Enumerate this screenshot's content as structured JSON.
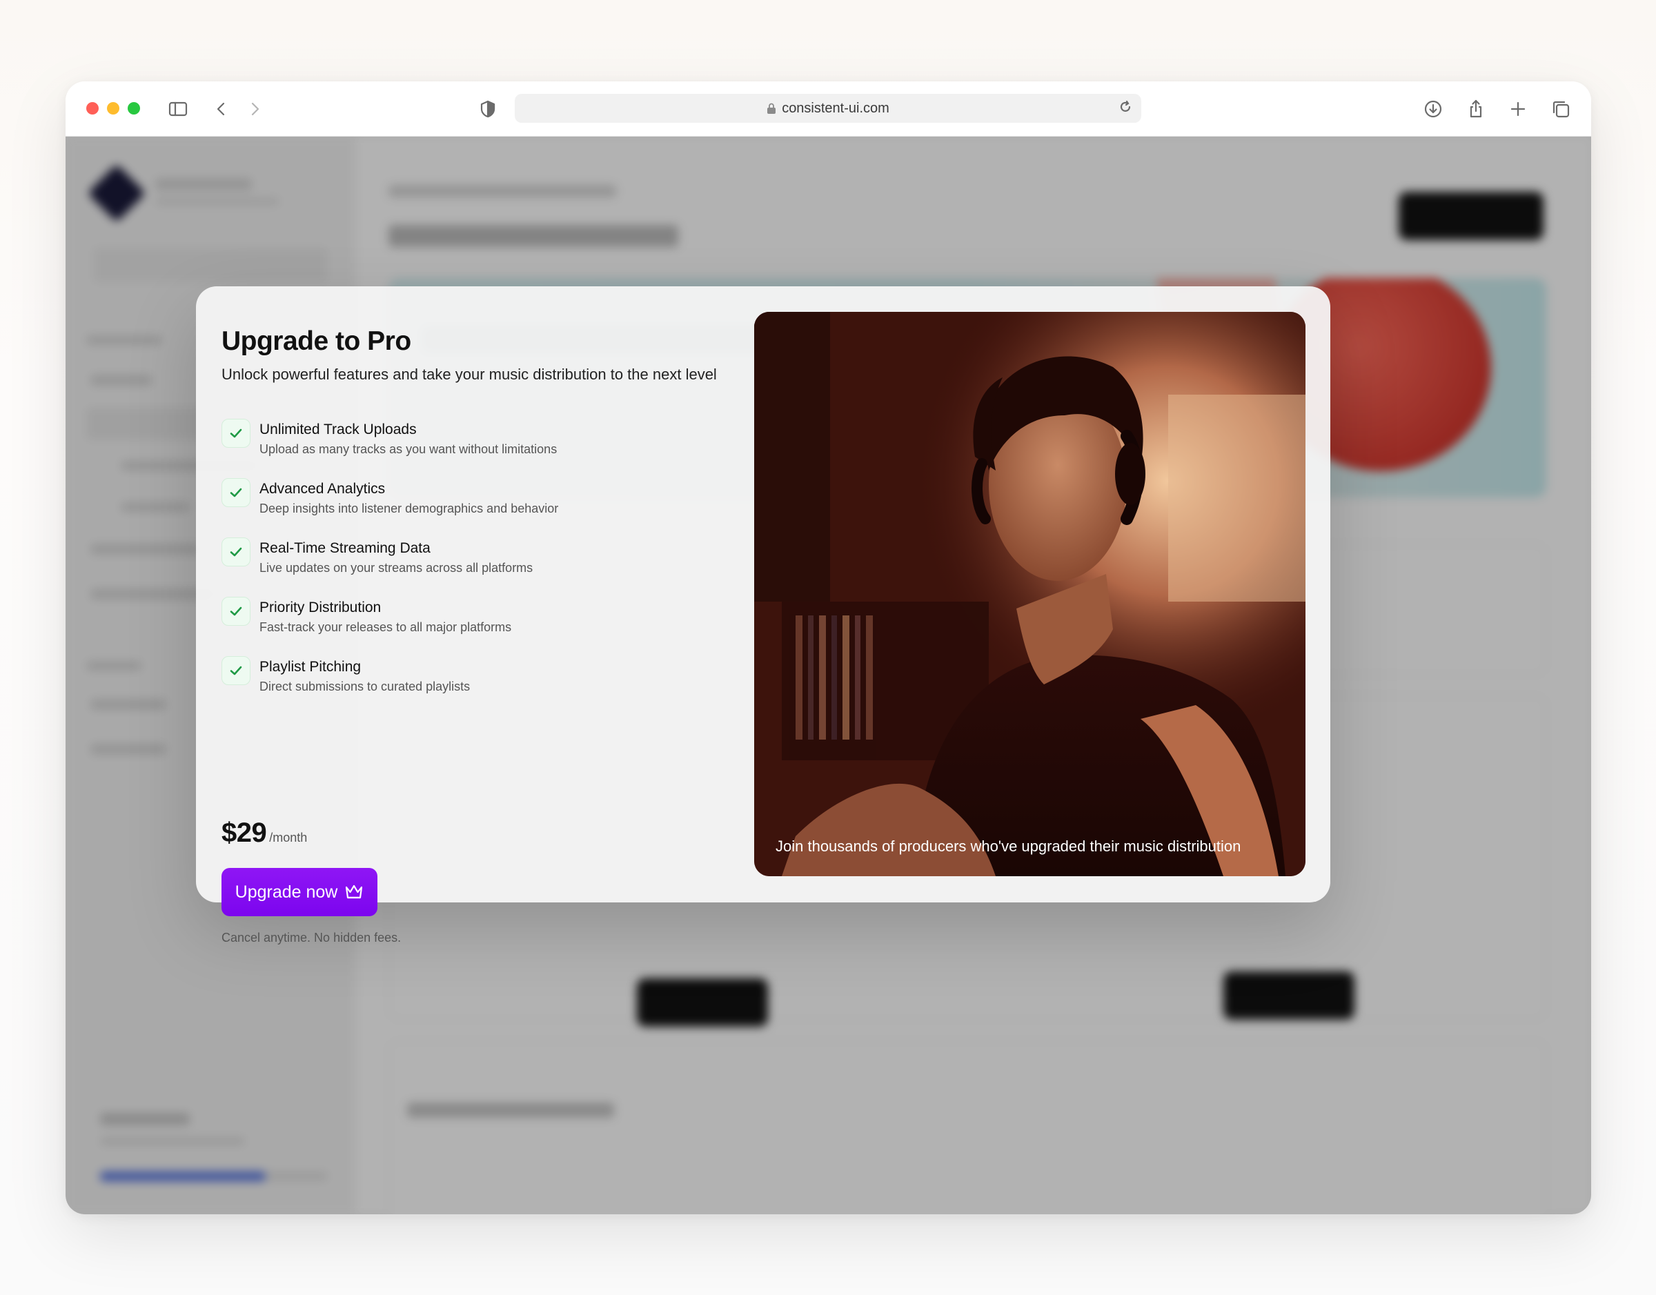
{
  "browser": {
    "url": "consistent-ui.com"
  },
  "modal": {
    "title": "Upgrade to Pro",
    "subtitle": "Unlock powerful features and take your music distribution to the next level",
    "features": [
      {
        "title": "Unlimited Track Uploads",
        "desc": "Upload as many tracks as you want without limitations"
      },
      {
        "title": "Advanced Analytics",
        "desc": "Deep insights into listener demographics and behavior"
      },
      {
        "title": "Real-Time Streaming Data",
        "desc": "Live updates on your streams across all platforms"
      },
      {
        "title": "Priority Distribution",
        "desc": "Fast-track your releases to all major platforms"
      },
      {
        "title": "Playlist Pitching",
        "desc": "Direct submissions to curated playlists"
      }
    ],
    "price": "$29",
    "price_period": "/month",
    "cta_label": "Upgrade now",
    "cta_icon": "crown-icon",
    "fine_print": "Cancel anytime. No hidden fees.",
    "photo_caption": "Join thousands of producers who've upgraded their music distribution"
  },
  "colors": {
    "accent": "#8f16f5",
    "check": "#1f9a45",
    "overlay": "rgba(0,0,0,0.30)"
  }
}
